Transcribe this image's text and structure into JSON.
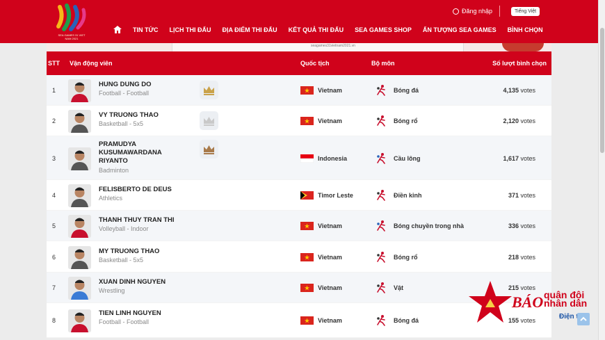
{
  "header": {
    "logo_caption": "SEA GAMES 31 VIET NAM 2021",
    "login_label": "Đăng nhập",
    "language_label": "Tiếng Việt",
    "nav": [
      "TIN TỨC",
      "LỊCH THI ĐẤU",
      "ĐỊA ĐIỂM THI ĐẤU",
      "KẾT QUẢ THI ĐẤU",
      "SEA GAMES SHOP",
      "ẤN TƯỢNG SEA GAMES",
      "BÌNH CHỌN"
    ]
  },
  "banner": {
    "text": "seagames31vietnam2021.vn"
  },
  "table": {
    "headers": {
      "stt": "STT",
      "athlete": "Vận động viên",
      "nationality": "Quốc tịch",
      "sport": "Bộ môn",
      "votes": "Số lượt bình chọn"
    },
    "rows": [
      {
        "stt": "1",
        "name": "HUNG DUNG DO",
        "sub": "Football - Football",
        "crown": "gold",
        "country": "Vietnam",
        "flag": "vn",
        "sport": "Bóng đá",
        "sport_icon": "football-icon",
        "votes_num": "4,135",
        "votes_unit": "votes"
      },
      {
        "stt": "2",
        "name": "VY TRUONG THAO",
        "sub": "Basketball - 5x5",
        "crown": "silver",
        "country": "Vietnam",
        "flag": "vn",
        "sport": "Bóng rổ",
        "sport_icon": "basketball-icon",
        "votes_num": "2,120",
        "votes_unit": "votes"
      },
      {
        "stt": "3",
        "name": "PRAMUDYA KUSUMAWARDANA RIYANTO",
        "sub": "Badminton",
        "crown": "bronze",
        "country": "Indonesia",
        "flag": "id",
        "sport": "Cầu lông",
        "sport_icon": "badminton-icon",
        "votes_num": "1,617",
        "votes_unit": "votes"
      },
      {
        "stt": "4",
        "name": "FELISBERTO DE DEUS",
        "sub": "Athletics",
        "crown": "",
        "country": "Timor Leste",
        "flag": "tl",
        "sport": "Điền kinh",
        "sport_icon": "athletics-icon",
        "votes_num": "371",
        "votes_unit": "votes"
      },
      {
        "stt": "5",
        "name": "THANH THUY TRAN THI",
        "sub": "Volleyball - Indoor",
        "crown": "",
        "country": "Vietnam",
        "flag": "vn",
        "sport": "Bóng chuyền trong nhà",
        "sport_icon": "volleyball-icon",
        "votes_num": "336",
        "votes_unit": "votes"
      },
      {
        "stt": "6",
        "name": "MY TRUONG THAO",
        "sub": "Basketball - 5x5",
        "crown": "",
        "country": "Vietnam",
        "flag": "vn",
        "sport": "Bóng rổ",
        "sport_icon": "basketball-icon",
        "votes_num": "218",
        "votes_unit": "votes"
      },
      {
        "stt": "7",
        "name": "XUAN DINH NGUYEN",
        "sub": "Wrestling",
        "crown": "",
        "country": "Vietnam",
        "flag": "vn",
        "sport": "Vật",
        "sport_icon": "wrestling-icon",
        "votes_num": "215",
        "votes_unit": "votes"
      },
      {
        "stt": "8",
        "name": "TIEN LINH NGUYEN",
        "sub": "Football - Football",
        "crown": "",
        "country": "Vietnam",
        "flag": "vn",
        "sport": "Bóng đá",
        "sport_icon": "football-icon",
        "votes_num": "155",
        "votes_unit": "votes"
      }
    ]
  },
  "watermark": {
    "line1": "BÁO",
    "line2a": "quân đội",
    "line2b": "nhân dân",
    "line3": "Điện tử"
  },
  "colors": {
    "primary": "#d0021b",
    "gold": "#c9a24a",
    "silver": "#c9c9c9",
    "bronze": "#a87a4a"
  }
}
